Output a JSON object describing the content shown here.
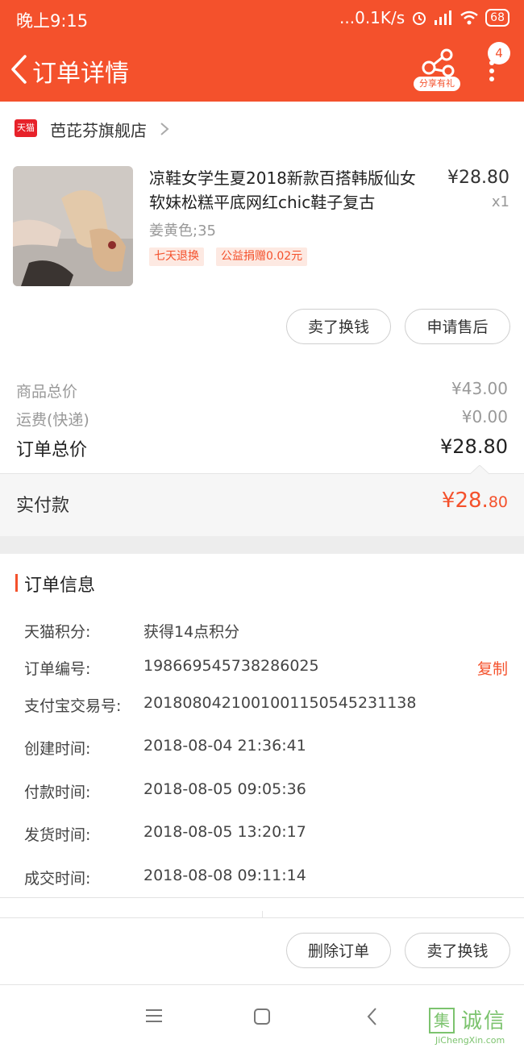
{
  "status_bar": {
    "time": "晚上9:15",
    "network": "...0.1K/s",
    "battery": "68"
  },
  "header": {
    "title": "订单详情",
    "share_label": "分享有礼",
    "badge_count": "4"
  },
  "store": {
    "logo_text": "天猫",
    "name": "芭芘芬旗舰店"
  },
  "product": {
    "title": "凉鞋女学生夏2018新款百搭韩版仙女软妹松糕平底网红chic鞋子复古",
    "sku": "姜黄色;35",
    "tags": [
      "七天退换",
      "公益捐赠0.02元"
    ],
    "price": "¥28.80",
    "qty": "x1"
  },
  "item_buttons": {
    "sell": "卖了换钱",
    "after_sale": "申请售后"
  },
  "summary": {
    "goods_label": "商品总价",
    "goods_value": "¥43.00",
    "shipping_label": "运费(快递)",
    "shipping_value": "¥0.00",
    "total_label": "订单总价",
    "total_value": "¥28.80",
    "paid_label": "实付款",
    "paid_int": "¥28.",
    "paid_dec": "80"
  },
  "order_info": {
    "title": "订单信息",
    "copy_label": "复制",
    "rows": [
      {
        "label": "天猫积分:",
        "value": "获得14点积分"
      },
      {
        "label": "订单编号:",
        "value": "198669545738286025"
      },
      {
        "label": "支付宝交易号:",
        "value": "2018080421001001150545231138"
      },
      {
        "label": "创建时间:",
        "value": "2018-08-04 21:36:41"
      },
      {
        "label": "付款时间:",
        "value": "2018-08-05 09:05:36"
      },
      {
        "label": "发货时间:",
        "value": "2018-08-05 13:20:17"
      },
      {
        "label": "成交时间:",
        "value": "2018-08-08 09:11:14"
      }
    ]
  },
  "bottom_buttons": {
    "delete": "删除订单",
    "sell": "卖了换钱"
  },
  "watermark": {
    "char": "集",
    "text": "诚信",
    "sub": "JiChengXin.com"
  },
  "colors": {
    "accent": "#f4512c",
    "watermark": "#7cc36e"
  }
}
